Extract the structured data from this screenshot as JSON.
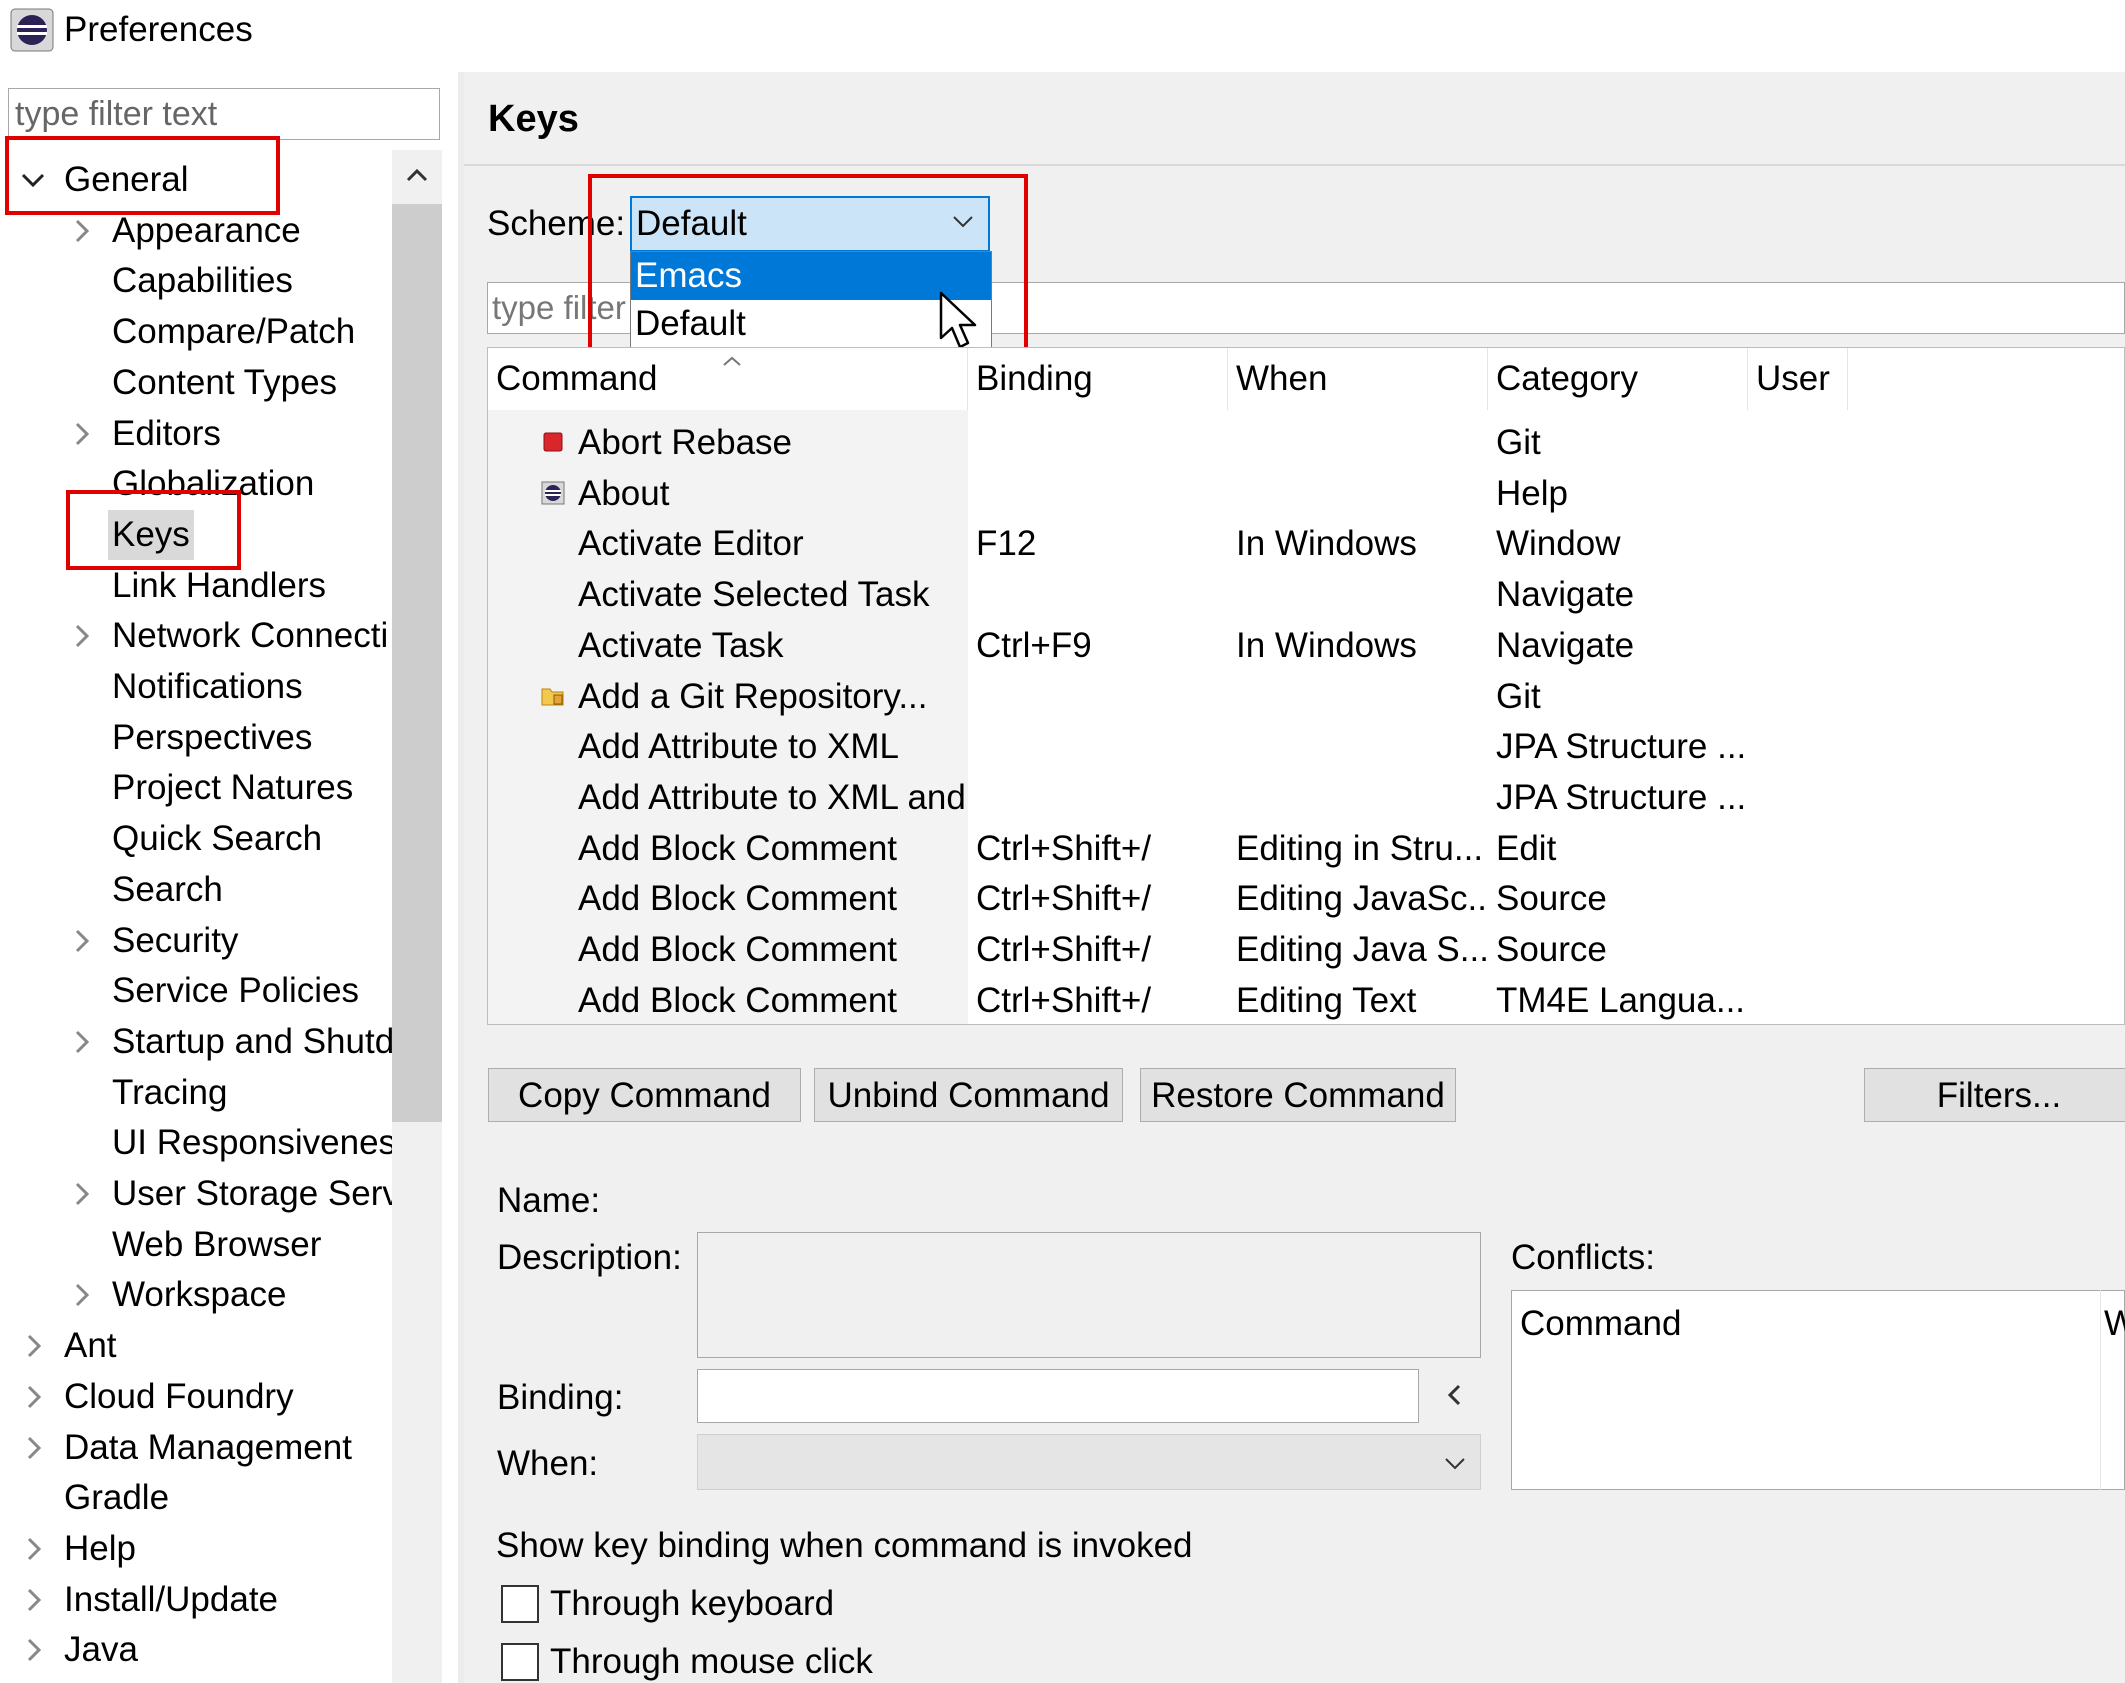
{
  "window": {
    "title": "Preferences"
  },
  "filter": {
    "placeholder": "type filter text"
  },
  "tree": [
    {
      "label": "General",
      "level": 0,
      "twisty": "expanded"
    },
    {
      "label": "Appearance",
      "level": 1,
      "twisty": "collapsed"
    },
    {
      "label": "Capabilities",
      "level": 1,
      "twisty": "none"
    },
    {
      "label": "Compare/Patch",
      "level": 1,
      "twisty": "none"
    },
    {
      "label": "Content Types",
      "level": 1,
      "twisty": "none"
    },
    {
      "label": "Editors",
      "level": 1,
      "twisty": "collapsed"
    },
    {
      "label": "Globalization",
      "level": 1,
      "twisty": "none"
    },
    {
      "label": "Keys",
      "level": 1,
      "twisty": "none",
      "selected": true
    },
    {
      "label": "Link Handlers",
      "level": 1,
      "twisty": "none"
    },
    {
      "label": "Network Connecti",
      "level": 1,
      "twisty": "collapsed"
    },
    {
      "label": "Notifications",
      "level": 1,
      "twisty": "none"
    },
    {
      "label": "Perspectives",
      "level": 1,
      "twisty": "none"
    },
    {
      "label": "Project Natures",
      "level": 1,
      "twisty": "none"
    },
    {
      "label": "Quick Search",
      "level": 1,
      "twisty": "none"
    },
    {
      "label": "Search",
      "level": 1,
      "twisty": "none"
    },
    {
      "label": "Security",
      "level": 1,
      "twisty": "collapsed"
    },
    {
      "label": "Service Policies",
      "level": 1,
      "twisty": "none"
    },
    {
      "label": "Startup and Shutd",
      "level": 1,
      "twisty": "collapsed"
    },
    {
      "label": "Tracing",
      "level": 1,
      "twisty": "none"
    },
    {
      "label": "UI Responsiveness",
      "level": 1,
      "twisty": "none"
    },
    {
      "label": "User Storage Serv",
      "level": 1,
      "twisty": "collapsed"
    },
    {
      "label": "Web Browser",
      "level": 1,
      "twisty": "none"
    },
    {
      "label": "Workspace",
      "level": 1,
      "twisty": "collapsed"
    },
    {
      "label": "Ant",
      "level": 0,
      "twisty": "collapsed"
    },
    {
      "label": "Cloud Foundry",
      "level": 0,
      "twisty": "collapsed"
    },
    {
      "label": "Data Management",
      "level": 0,
      "twisty": "collapsed"
    },
    {
      "label": "Gradle",
      "level": 0,
      "twisty": "none"
    },
    {
      "label": "Help",
      "level": 0,
      "twisty": "collapsed"
    },
    {
      "label": "Install/Update",
      "level": 0,
      "twisty": "collapsed"
    },
    {
      "label": "Java",
      "level": 0,
      "twisty": "collapsed"
    }
  ],
  "page": {
    "title": "Keys"
  },
  "scheme": {
    "label": "Scheme:",
    "value": "Default",
    "options": [
      "Emacs",
      "Default"
    ],
    "highlighted": "Emacs"
  },
  "command_filter": {
    "placeholder": "type filter text"
  },
  "table": {
    "columns": [
      "Command",
      "Binding",
      "When",
      "Category",
      "User"
    ],
    "rows": [
      {
        "command": "Abort Rebase",
        "binding": "",
        "when": "",
        "category": "Git",
        "user": "",
        "icon": "stop-icon"
      },
      {
        "command": "About",
        "binding": "",
        "when": "",
        "category": "Help",
        "user": "",
        "icon": "eclipse-icon"
      },
      {
        "command": "Activate Editor",
        "binding": "F12",
        "when": "In Windows",
        "category": "Window",
        "user": "",
        "icon": ""
      },
      {
        "command": "Activate Selected Task",
        "binding": "",
        "when": "",
        "category": "Navigate",
        "user": "",
        "icon": ""
      },
      {
        "command": "Activate Task",
        "binding": "Ctrl+F9",
        "when": "In Windows",
        "category": "Navigate",
        "user": "",
        "icon": ""
      },
      {
        "command": "Add a Git Repository...",
        "binding": "",
        "when": "",
        "category": "Git",
        "user": "",
        "icon": "git-repository-icon"
      },
      {
        "command": "Add Attribute to XML",
        "binding": "",
        "when": "",
        "category": "JPA Structure ...",
        "user": "",
        "icon": ""
      },
      {
        "command": "Add Attribute to XML and",
        "binding": "",
        "when": "",
        "category": "JPA Structure ...",
        "user": "",
        "icon": ""
      },
      {
        "command": "Add Block Comment",
        "binding": "Ctrl+Shift+/",
        "when": "Editing in Stru...",
        "category": "Edit",
        "user": "",
        "icon": ""
      },
      {
        "command": "Add Block Comment",
        "binding": "Ctrl+Shift+/",
        "when": "Editing JavaSc...",
        "category": "Source",
        "user": "",
        "icon": ""
      },
      {
        "command": "Add Block Comment",
        "binding": "Ctrl+Shift+/",
        "when": "Editing Java S...",
        "category": "Source",
        "user": "",
        "icon": ""
      },
      {
        "command": "Add Block Comment",
        "binding": "Ctrl+Shift+/",
        "when": "Editing Text",
        "category": "TM4E Langua...",
        "user": "",
        "icon": ""
      }
    ]
  },
  "buttons": {
    "copy": "Copy Command",
    "unbind": "Unbind Command",
    "restore": "Restore Command",
    "filters": "Filters..."
  },
  "details": {
    "name_label": "Name:",
    "description_label": "Description:",
    "binding_label": "Binding:",
    "when_label": "When:",
    "conflicts_label": "Conflicts:",
    "conflicts_columns": [
      "Command",
      "W"
    ]
  },
  "show_binding": {
    "title": "Show key binding when command is invoked",
    "through_keyboard": "Through keyboard",
    "through_mouse": "Through mouse click"
  },
  "colors": {
    "highlight_box": "#e00000",
    "selection": "#0078d7",
    "combo_focus": "#cce4f7",
    "panel_bg": "#f0f0f0"
  }
}
